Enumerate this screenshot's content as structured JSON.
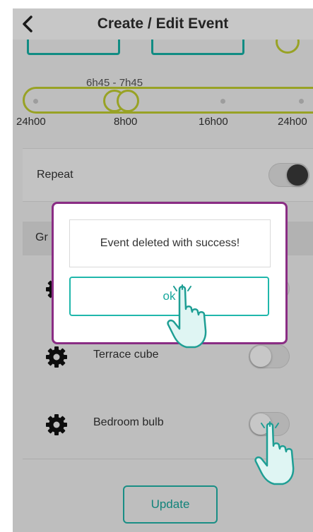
{
  "header": {
    "title": "Create / Edit Event"
  },
  "time_range": {
    "range_label": "6h45 - 7h45",
    "ticks": [
      "24h00",
      "8h00",
      "16h00",
      "24h00"
    ]
  },
  "repeat": {
    "label": "Repeat",
    "enabled": true
  },
  "devices": {
    "header_label": "Gr",
    "items": [
      {
        "label": "Terrace cube",
        "icon": "gear-icon",
        "enabled": false
      },
      {
        "label": "Bedroom bulb",
        "icon": "gear-icon",
        "enabled": false
      }
    ]
  },
  "actions": {
    "update_label": "Update"
  },
  "dialog": {
    "message": "Event deleted with success!",
    "ok_label": "ok"
  },
  "colors": {
    "accent": "#20b7ab",
    "slider": "#c3d030",
    "dialog_border": "#8a2d84"
  }
}
